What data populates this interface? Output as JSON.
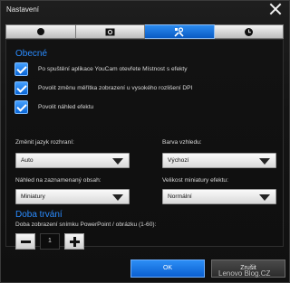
{
  "window": {
    "title": "Nastavení"
  },
  "tabs": [
    {
      "icon": "circle-icon",
      "active": false
    },
    {
      "icon": "camera-icon",
      "active": false
    },
    {
      "icon": "tools-icon",
      "active": true
    },
    {
      "icon": "clock-icon",
      "active": false
    }
  ],
  "general": {
    "heading": "Obecné",
    "options": [
      {
        "label": "Po spuštění aplikace YouCam otevřete Místnost s efekty",
        "checked": true
      },
      {
        "label": "Povolit změnu měřítka zobrazení u vysokého rozlišení DPI",
        "checked": true
      },
      {
        "label": "Povolit náhled efektu",
        "checked": true
      }
    ]
  },
  "fields": {
    "language": {
      "label": "Změnit jazyk rozhraní:",
      "value": "Auto"
    },
    "color": {
      "label": "Barva vzhledu:",
      "value": "Výchozí"
    },
    "preview": {
      "label": "Náhled na zaznamenaný obsah:",
      "value": "Miniatury"
    },
    "thumbsize": {
      "label": "Velikost miniatury efektu:",
      "value": "Normální"
    }
  },
  "duration": {
    "heading": "Doba trvání",
    "label": "Doba zobrazení snímku PowerPoint / obrázku (1-60):",
    "value": "1"
  },
  "buttons": {
    "ok": "OK",
    "cancel": "Zrušit"
  },
  "watermark": "Lenovo Blog.CZ",
  "colors": {
    "accent": "#2b8cff",
    "active_tab": "#0a5bc4"
  }
}
